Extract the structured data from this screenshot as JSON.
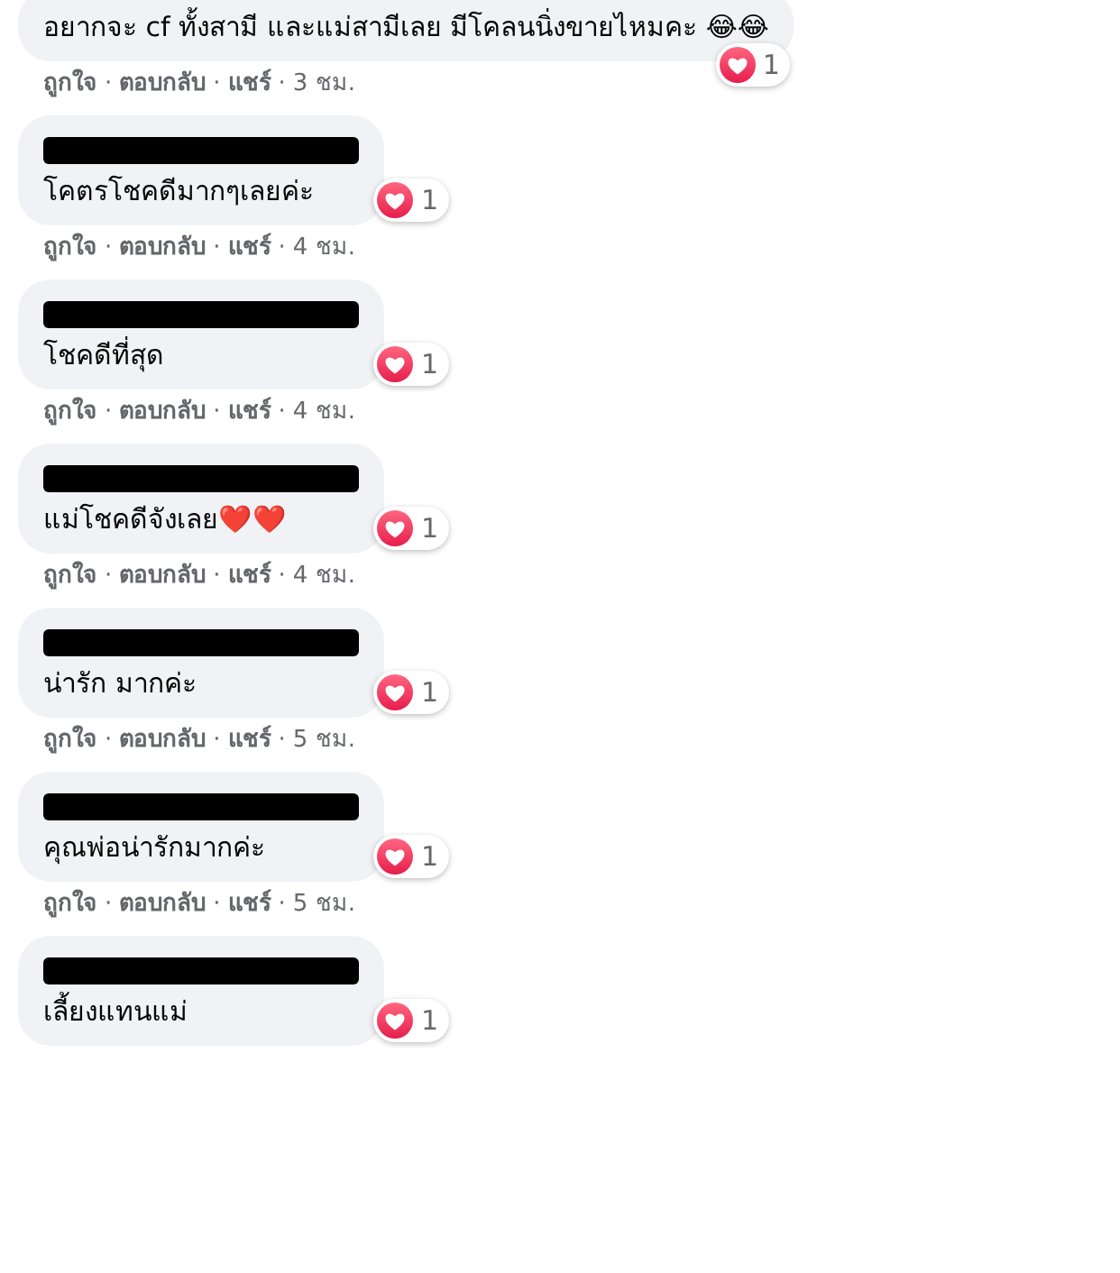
{
  "separator": "·",
  "comments": [
    {
      "text": "อยากจะ cf ทั้งสามี และแม่สามีเลย มีโคลนนิ่งขายไหมคะ 😂😂",
      "reaction_count": "1",
      "actions": [
        "ถูกใจ",
        "ตอบกลับ",
        "แชร์"
      ],
      "time": "3 ชม."
    },
    {
      "name_redacted": true,
      "text": "โคตรโชคดีมากๆเลยค่ะ",
      "reaction_count": "1",
      "actions": [
        "ถูกใจ",
        "ตอบกลับ",
        "แชร์"
      ],
      "time": "4 ชม."
    },
    {
      "name_redacted": true,
      "text": "โชคดีที่สุด",
      "reaction_count": "1",
      "actions": [
        "ถูกใจ",
        "ตอบกลับ",
        "แชร์"
      ],
      "time": "4 ชม."
    },
    {
      "name_redacted": true,
      "text": "แม่โชคดีจังเลย❤️❤️",
      "reaction_count": "1",
      "actions": [
        "ถูกใจ",
        "ตอบกลับ",
        "แชร์"
      ],
      "time": "4 ชม."
    },
    {
      "name_redacted": true,
      "text": "น่ารัก มากค่ะ",
      "reaction_count": "1",
      "actions": [
        "ถูกใจ",
        "ตอบกลับ",
        "แชร์"
      ],
      "time": "5 ชม."
    },
    {
      "name_redacted": true,
      "text": "คุณพ่อน่ารักมากค่ะ",
      "reaction_count": "1",
      "actions": [
        "ถูกใจ",
        "ตอบกลับ",
        "แชร์"
      ],
      "time": "5 ชม."
    },
    {
      "name_redacted": true,
      "text": "เลี้ยงแทนแม่",
      "reaction_count": "1"
    }
  ]
}
